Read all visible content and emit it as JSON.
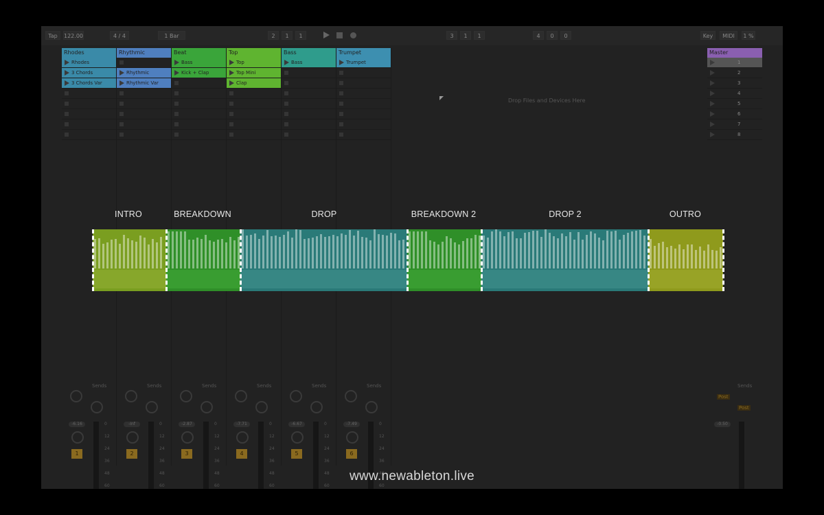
{
  "control_bar": {
    "tap": "Tap",
    "tempo": "122.00",
    "meter": "4 / 4",
    "quant": "1 Bar",
    "pos1": "2",
    "pos2": "1",
    "pos3": "1",
    "loop1": "3",
    "loop2": "1",
    "loop3": "1",
    "len1": "4",
    "len2": "0",
    "len3": "0",
    "key": "Key",
    "midi": "MIDI",
    "cpu": "1 %"
  },
  "tracks": [
    {
      "name": "Rhodes",
      "color": "#3a8aa8",
      "clips": [
        "Rhodes",
        "3 Chords",
        "3 Chords Var"
      ],
      "num": "1",
      "vol": "-6.16"
    },
    {
      "name": "Rhythmic",
      "color": "#4f7fbf",
      "clips": [
        "",
        "Rhythmic",
        "Rhythmic Var"
      ],
      "num": "2",
      "vol": "-Inf"
    },
    {
      "name": "Beat",
      "color": "#3aa53a",
      "clips": [
        "Bass",
        "Kick + Clap",
        ""
      ],
      "num": "3",
      "vol": "-2.87"
    },
    {
      "name": "Top",
      "color": "#5fb430",
      "clips": [
        "Top",
        "Top Mini",
        "Clap"
      ],
      "num": "4",
      "vol": "-7.71"
    },
    {
      "name": "Bass",
      "color": "#2f9c8c",
      "clips": [
        "Bass",
        "",
        ""
      ],
      "num": "5",
      "vol": "-6.67"
    },
    {
      "name": "Trumpet",
      "color": "#3d8fb0",
      "clips": [
        "Trumpet",
        "",
        ""
      ],
      "num": "6",
      "vol": "-7.49"
    }
  ],
  "master": {
    "name": "Master",
    "scenes": [
      "1",
      "2",
      "3",
      "4",
      "5",
      "6",
      "7",
      "8"
    ],
    "vol": "-0.50",
    "send_labels": [
      "Post",
      "Post"
    ]
  },
  "sends_label": "Sends",
  "drop_hint": "Drop Files and Devices Here",
  "meter_scale": [
    "0",
    "12",
    "24",
    "36",
    "48",
    "60"
  ],
  "sections": [
    {
      "label": "INTRO",
      "color": "#7a9e20",
      "low": "#8aa82e"
    },
    {
      "label": "BREAKDOWN",
      "color": "#2f8f28",
      "low": "#3ba032"
    },
    {
      "label": "DROP",
      "color": "#2a7a78",
      "low": "#3a8a86"
    },
    {
      "label": "BREAKDOWN 2",
      "color": "#2f8f28",
      "low": "#3ba032"
    },
    {
      "label": "DROP 2",
      "color": "#2a7a78",
      "low": "#3a8a86"
    },
    {
      "label": "OUTRO",
      "color": "#8f9a1c",
      "low": "#9aa528"
    }
  ],
  "footer_url": "www.newableton.live"
}
